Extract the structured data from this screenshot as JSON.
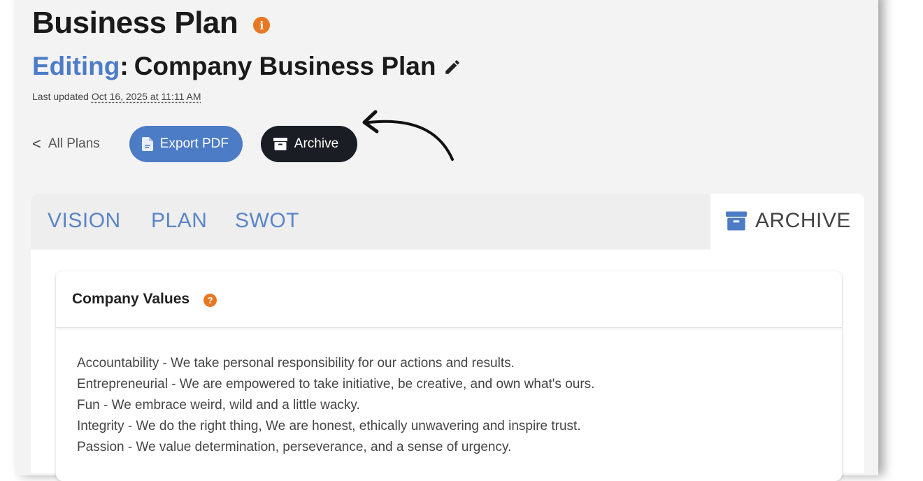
{
  "header": {
    "title": "Business Plan",
    "info_glyph": "i",
    "editing_label": "Editing",
    "editing_colon": ":",
    "plan_name": "Company Business Plan",
    "last_updated_label": "Last updated",
    "last_updated_value": "Oct 16, 2025 at 11:11 AM"
  },
  "actions": {
    "back_chevron": "<",
    "back_label": "All Plans",
    "export_label": "Export PDF",
    "archive_label": "Archive"
  },
  "tabs": [
    {
      "label": "VISION"
    },
    {
      "label": "PLAN"
    },
    {
      "label": "SWOT"
    },
    {
      "label": "ARCHIVE"
    }
  ],
  "values_card": {
    "title": "Company Values",
    "help_glyph": "?",
    "lines": [
      "Accountability - We take personal responsibility for our actions and results.",
      "Entrepreneurial - We are empowered to take initiative, be creative, and own what's ours.",
      "Fun - We embrace weird, wild and a little wacky.",
      "Integrity - We do the right thing, We are honest, ethically unwavering and inspire trust.",
      "Passion - We value determination, perseverance, and a sense of urgency."
    ]
  },
  "colors": {
    "accent_blue": "#4d7cc6",
    "dark_button": "#1a1d24",
    "orange_badge": "#e87722"
  },
  "icons": [
    "info-icon",
    "pencil-icon",
    "chevron-left-icon",
    "pdf-file-icon",
    "archive-box-icon",
    "help-icon",
    "annotation-arrow"
  ]
}
